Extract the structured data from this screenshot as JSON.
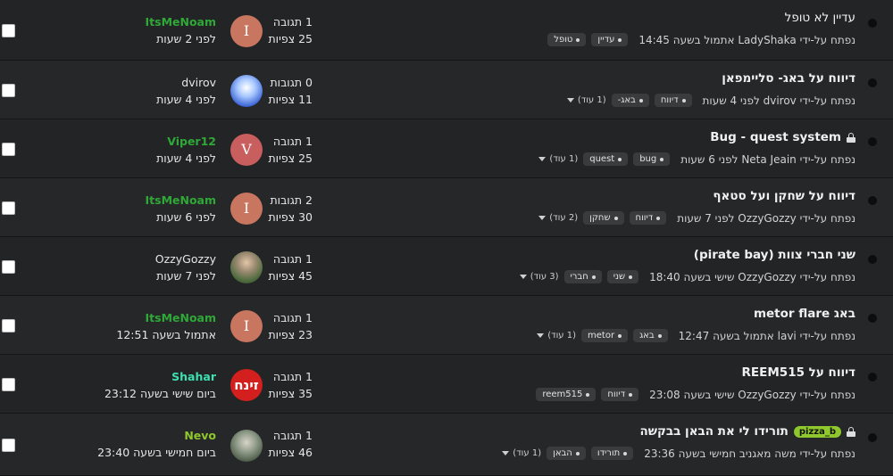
{
  "topics": [
    {
      "title": "עדיין לא טופל",
      "bold": false,
      "locked": false,
      "prefix": "",
      "started": "נפתח על-ידי LadyShaka אתמול בשעה 14:45",
      "tags": [
        "עדיין",
        "טופל"
      ],
      "more": "",
      "replies": "1 תגובה",
      "views": "25 צפיות",
      "avatar": {
        "type": "letter",
        "letter": "I"
      },
      "last_user": "ItsMeNoam",
      "last_user_color": "green",
      "last_time": "לפני 2 שעות"
    },
    {
      "title": "דיווח על באג- סליימפאן",
      "bold": true,
      "locked": false,
      "prefix": "",
      "started": "נפתח על-ידי dvirov לפני 4 שעות",
      "tags": [
        "דיווח",
        "באג-"
      ],
      "more": "(1 עוד)",
      "replies": "0 תגובות",
      "views": "11 צפיות",
      "avatar": {
        "type": "blue",
        "letter": ""
      },
      "last_user": "dvirov",
      "last_user_color": "plain",
      "last_time": "לפני 4 שעות"
    },
    {
      "title": "Bug - quest system",
      "bold": true,
      "locked": true,
      "prefix": "",
      "started": "נפתח על-ידי Neta Jeain לפני 6 שעות",
      "tags": [
        "bug",
        "quest"
      ],
      "more": "(1 עוד)",
      "replies": "1 תגובה",
      "views": "25 צפיות",
      "avatar": {
        "type": "v",
        "letter": "V"
      },
      "last_user": "Viper12",
      "last_user_color": "green",
      "last_time": "לפני 4 שעות"
    },
    {
      "title": "דיווח על שחקן ועל סטאף",
      "bold": true,
      "locked": false,
      "prefix": "",
      "started": "נפתח על-ידי OzzyGozzy לפני 7 שעות",
      "tags": [
        "דיווח",
        "שחקן"
      ],
      "more": "(2 עוד)",
      "replies": "2 תגובות",
      "views": "30 צפיות",
      "avatar": {
        "type": "letter",
        "letter": "I"
      },
      "last_user": "ItsMeNoam",
      "last_user_color": "green",
      "last_time": "לפני 6 שעות"
    },
    {
      "title": "שני חברי צוות (pirate bay)",
      "bold": true,
      "locked": false,
      "prefix": "",
      "started": "נפתח על-ידי OzzyGozzy שישי בשעה 18:40",
      "tags": [
        "שני",
        "חברי"
      ],
      "more": "(3 עוד)",
      "replies": "1 תגובה",
      "views": "45 צפיות",
      "avatar": {
        "type": "photo",
        "letter": ""
      },
      "last_user": "OzzyGozzy",
      "last_user_color": "plain",
      "last_time": "לפני 7 שעות"
    },
    {
      "title": "באג metor flare",
      "bold": true,
      "locked": false,
      "prefix": "",
      "started": "נפתח על-ידי lavi אתמול בשעה 12:47",
      "tags": [
        "באג",
        "metor"
      ],
      "more": "(1 עוד)",
      "replies": "1 תגובה",
      "views": "23 צפיות",
      "avatar": {
        "type": "letter",
        "letter": "I"
      },
      "last_user": "ItsMeNoam",
      "last_user_color": "green",
      "last_time": "אתמול בשעה 12:51"
    },
    {
      "title": "דיווח על REEM515",
      "bold": true,
      "locked": false,
      "prefix": "",
      "started": "נפתח על-ידי OzzyGozzy שישי בשעה 23:08",
      "tags": [
        "דיווח",
        "reem515"
      ],
      "more": "",
      "replies": "1 תגובה",
      "views": "35 צפיות",
      "avatar": {
        "type": "red",
        "letter": "זינח"
      },
      "last_user": "Shahar",
      "last_user_color": "teal",
      "last_time": "ביום שישי בשעה 23:12"
    },
    {
      "title": "תורידו לי את הבאן בבקשה",
      "bold": true,
      "locked": true,
      "prefix": "pizza_b",
      "started": "נפתח על-ידי משה מאגניב חמישי בשעה 23:36",
      "tags": [
        "תורידו",
        "הבאן"
      ],
      "more": "(1 עוד)",
      "replies": "1 תגובה",
      "views": "46 צפיות",
      "avatar": {
        "type": "photo2",
        "letter": ""
      },
      "last_user": "Nevo",
      "last_user_color": "lime",
      "last_time": "ביום חמישי בשעה 23:40"
    }
  ]
}
